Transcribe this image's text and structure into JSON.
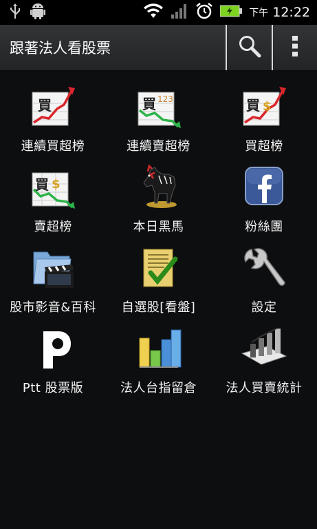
{
  "status_bar": {
    "ampm": "下午",
    "time": "12:22"
  },
  "action_bar": {
    "title": "跟著法人看股票"
  },
  "menu": [
    {
      "label": "連續買超榜",
      "icon": "buy-chart-up-icon"
    },
    {
      "label": "連續賣超榜",
      "icon": "sell-chart-123-icon"
    },
    {
      "label": "買超榜",
      "icon": "buy-chart-dollar-icon"
    },
    {
      "label": "賣超榜",
      "icon": "sell-chart-dollar-icon"
    },
    {
      "label": "本日黑馬",
      "icon": "dark-horse-icon"
    },
    {
      "label": "粉絲團",
      "icon": "facebook-icon"
    },
    {
      "label": "股市影音&百科",
      "icon": "video-folder-icon"
    },
    {
      "label": "自選股[看盤]",
      "icon": "watchlist-check-icon"
    },
    {
      "label": "設定",
      "icon": "wrench-icon"
    },
    {
      "label": "Ptt 股票版",
      "icon": "ptt-icon"
    },
    {
      "label": "法人台指留倉",
      "icon": "bar-chart-icon"
    },
    {
      "label": "法人買賣統計",
      "icon": "stats-chart-icon"
    }
  ],
  "colors": {
    "background": "#0d0e10",
    "action_bar": "#2b2c2e",
    "battery": "#7ed321",
    "chart_green": "#2db34a",
    "chart_red": "#d9262c",
    "facebook": "#3b5998"
  }
}
